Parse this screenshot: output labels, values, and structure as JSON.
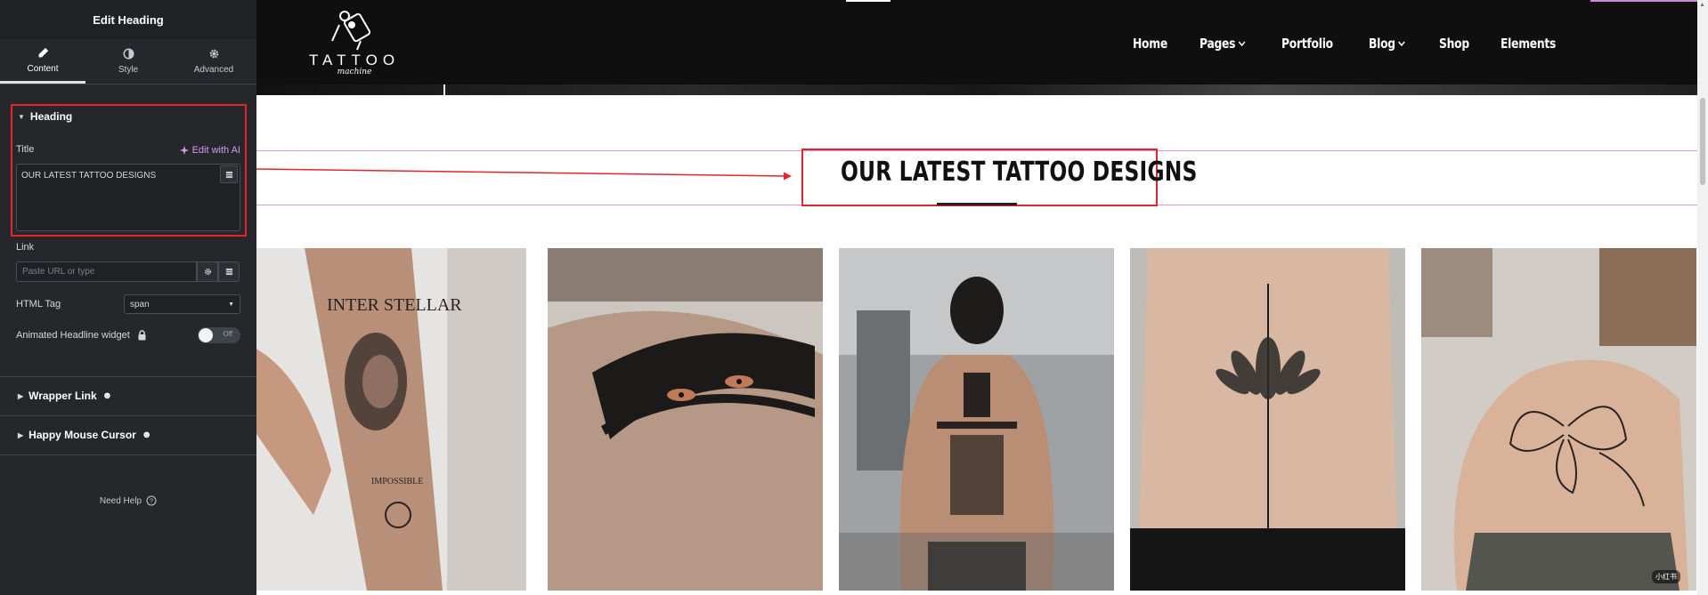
{
  "panel": {
    "title": "Edit Heading",
    "tabs": [
      {
        "label": "Content",
        "icon": "pencil-icon"
      },
      {
        "label": "Style",
        "icon": "contrast-icon"
      },
      {
        "label": "Advanced",
        "icon": "gear-icon"
      }
    ],
    "heading_section": "Heading",
    "title_label": "Title",
    "edit_ai": "Edit with AI",
    "title_value": "OUR LATEST TATTOO DESIGNS",
    "link_label": "Link",
    "link_placeholder": "Paste URL or type",
    "html_tag_label": "HTML Tag",
    "html_tag_value": "span",
    "animated_label": "Animated Headline widget",
    "toggle_text": "Off",
    "wrapper_link": "Wrapper Link",
    "happy_cursor": "Happy Mouse Cursor",
    "need_help": "Need Help",
    "highlight_color": "#e3262e",
    "accent_color": "#d49cf0"
  },
  "site": {
    "logo_title": "TATTOO",
    "logo_sub": "machine",
    "nav": [
      {
        "label": "Home",
        "dropdown": false
      },
      {
        "label": "Pages",
        "dropdown": true
      },
      {
        "label": "Portfolio",
        "dropdown": false
      },
      {
        "label": "Blog",
        "dropdown": true
      },
      {
        "label": "Shop",
        "dropdown": false
      },
      {
        "label": "Elements",
        "dropdown": false
      }
    ],
    "section_heading": "OUR LATEST TATTOO DESIGNS",
    "gallery_badge": "小红书",
    "gallery": [
      {
        "alt": "forearm portrait tattoo"
      },
      {
        "alt": "tiger eyes armband tattoo"
      },
      {
        "alt": "back sak yant tattoo"
      },
      {
        "alt": "spine lotus tattoo"
      },
      {
        "alt": "shoulder butterfly tattoo"
      }
    ]
  }
}
